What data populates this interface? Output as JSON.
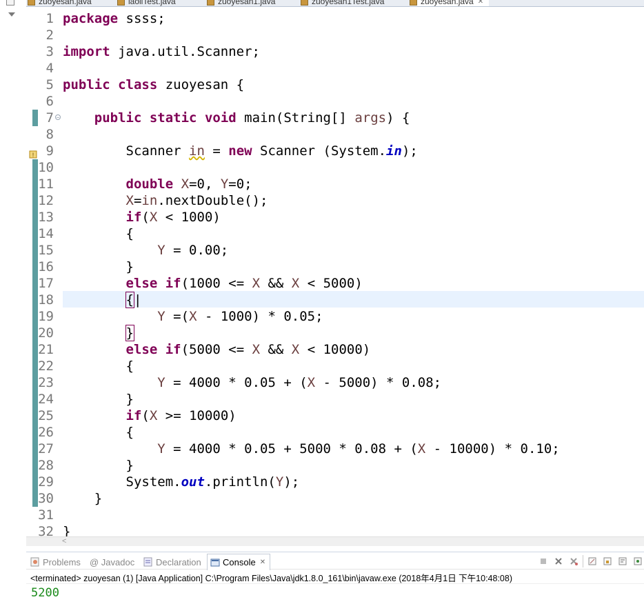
{
  "tabs": [
    {
      "label": "zuoyesan.java",
      "active": false
    },
    {
      "label": "laoliTest.java",
      "active": false
    },
    {
      "label": "zuoyesan1.java",
      "active": false
    },
    {
      "label": "zuoyesan1Test.java",
      "active": false
    },
    {
      "label": "zuoyesan.java",
      "active": true
    }
  ],
  "editor": {
    "current_line": 18,
    "lines": [
      {
        "n": "1",
        "html": "<span class=\"kw\">package</span> ssss;"
      },
      {
        "n": "2",
        "html": ""
      },
      {
        "n": "3",
        "html": "<span class=\"kw\">import</span> java.util.Scanner;"
      },
      {
        "n": "4",
        "html": ""
      },
      {
        "n": "5",
        "html": "<span class=\"kw\">public</span> <span class=\"kw\">class</span> zuoyesan {"
      },
      {
        "n": "6",
        "html": ""
      },
      {
        "n": "7",
        "html": "    <span class=\"kw\">public</span> <span class=\"kw\">static</span> <span class=\"kw\">void</span> main(String[] <span class=\"var\">args</span>) {"
      },
      {
        "n": "8",
        "html": ""
      },
      {
        "n": "9",
        "html": "        Scanner <span class=\"var warn-ul\">in</span> = <span class=\"kw\">new</span> Scanner (System.<span class=\"fld\">in</span>);"
      },
      {
        "n": "10",
        "html": ""
      },
      {
        "n": "11",
        "html": "        <span class=\"kw\">double</span> <span class=\"var\">X</span>=0, <span class=\"var\">Y</span>=0;"
      },
      {
        "n": "12",
        "html": "        <span class=\"var\">X</span>=<span class=\"var\">in</span>.nextDouble();"
      },
      {
        "n": "13",
        "html": "        <span class=\"kw\">if</span>(<span class=\"var\">X</span> &lt; 1000)"
      },
      {
        "n": "14",
        "html": "        {"
      },
      {
        "n": "15",
        "html": "            <span class=\"var\">Y</span> = 0.00;"
      },
      {
        "n": "16",
        "html": "        }"
      },
      {
        "n": "17",
        "html": "        <span class=\"kw\">else</span> <span class=\"kw\">if</span>(1000 &lt;= <span class=\"var\">X</span> &amp;&amp; <span class=\"var\">X</span> &lt; 5000)"
      },
      {
        "n": "18",
        "html": "        <span style=\"outline:1px solid #7f0055\">{</span>|"
      },
      {
        "n": "19",
        "html": "            <span class=\"var\">Y</span> =(<span class=\"var\">X</span> - 1000) * 0.05;"
      },
      {
        "n": "20",
        "html": "        <span style=\"outline:1px solid #7f0055\">}</span>"
      },
      {
        "n": "21",
        "html": "        <span class=\"kw\">else</span> <span class=\"kw\">if</span>(5000 &lt;= <span class=\"var\">X</span> &amp;&amp; <span class=\"var\">X</span> &lt; 10000)"
      },
      {
        "n": "22",
        "html": "        {"
      },
      {
        "n": "23",
        "html": "            <span class=\"var\">Y</span> = 4000 * 0.05 + (<span class=\"var\">X</span> - 5000) * 0.08;"
      },
      {
        "n": "24",
        "html": "        }"
      },
      {
        "n": "25",
        "html": "        <span class=\"kw\">if</span>(<span class=\"var\">X</span> &gt;= 10000)"
      },
      {
        "n": "26",
        "html": "        {"
      },
      {
        "n": "27",
        "html": "            <span class=\"var\">Y</span> = 4000 * 0.05 + 5000 * 0.08 + (<span class=\"var\">X</span> - 10000) * 0.10;"
      },
      {
        "n": "28",
        "html": "        }"
      },
      {
        "n": "29",
        "html": "        System.<span class=\"fld\">out</span>.println(<span class=\"var\">Y</span>);"
      },
      {
        "n": "30",
        "html": "    }"
      },
      {
        "n": "31",
        "html": ""
      },
      {
        "n": "32",
        "html": "}"
      }
    ]
  },
  "views": {
    "tabs": [
      {
        "label": "Problems",
        "icon": "problems-icon"
      },
      {
        "label": "@ Javadoc",
        "icon": ""
      },
      {
        "label": "Declaration",
        "icon": "declaration-icon"
      },
      {
        "label": "Console",
        "icon": "console-icon",
        "active": true
      }
    ],
    "close_glyph": "✕"
  },
  "console": {
    "status": "<terminated> zuoyesan (1) [Java Application] C:\\Program Files\\Java\\jdk1.8.0_161\\bin\\javaw.exe (2018年4月1日 下午10:48:08)",
    "output": "5200"
  },
  "colors": {
    "keyword": "#7f0055",
    "field": "#0000c0",
    "variable": "#6a3e3e",
    "current_line": "#e8f2fe",
    "output": "#1a8a1a"
  }
}
